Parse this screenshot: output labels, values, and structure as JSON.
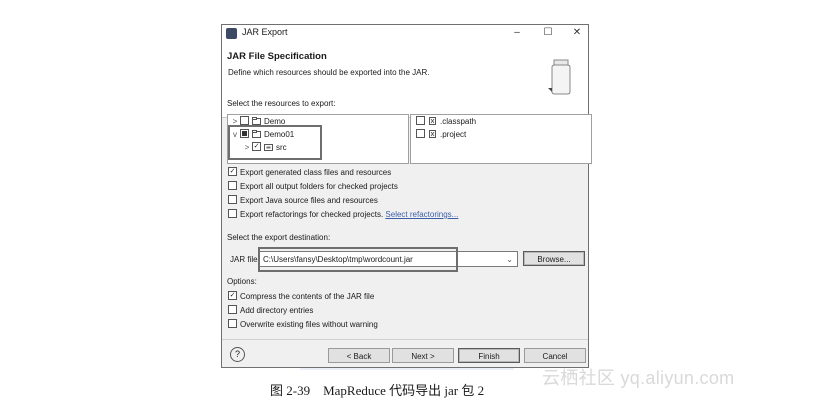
{
  "window": {
    "title": "JAR Export",
    "controls": {
      "minimize": "–",
      "maximize": "☐",
      "close": "✕"
    }
  },
  "header": {
    "title": "JAR File Specification",
    "description": "Define which resources should be exported into the JAR."
  },
  "resources_label": "Select the resources to export:",
  "tree": [
    {
      "expander": ">",
      "state": "unchecked",
      "label": "Demo",
      "icon": "project-icon"
    },
    {
      "expander": "v",
      "state": "partial",
      "label": "Demo01",
      "icon": "project-icon"
    },
    {
      "expander": ">",
      "state": "checked",
      "label": "src",
      "icon": "package-folder-icon"
    }
  ],
  "files": [
    {
      "state": "unchecked",
      "label": ".classpath",
      "icon": "xml-file-icon"
    },
    {
      "state": "unchecked",
      "label": ".project",
      "icon": "xml-file-icon"
    }
  ],
  "export_options": [
    {
      "state": "checked",
      "label": "Export generated class files and resources"
    },
    {
      "state": "unchecked",
      "label": "Export all output folders for checked projects"
    },
    {
      "state": "unchecked",
      "label": "Export Java source files and resources"
    },
    {
      "state": "unchecked",
      "label": "Export refactorings for checked projects.",
      "link": "Select refactorings..."
    }
  ],
  "destination": {
    "label": "Select the export destination:",
    "jar_label": "JAR file:",
    "jar_value": "C:\\Users\\fansy\\Desktop\\tmp\\wordcount.jar",
    "browse": "Browse..."
  },
  "options": {
    "label": "Options:",
    "items": [
      {
        "state": "checked",
        "label": "Compress the contents of the JAR file"
      },
      {
        "state": "unchecked",
        "label": "Add directory entries"
      },
      {
        "state": "unchecked",
        "label": "Overwrite existing files without warning"
      }
    ]
  },
  "buttons": {
    "help": "?",
    "back": "< Back",
    "next": "Next >",
    "finish": "Finish",
    "cancel": "Cancel"
  },
  "caption": "图 2-39　MapReduce 代码导出 jar 包 2",
  "watermark": "云栖社区 yq.aliyun.com"
}
